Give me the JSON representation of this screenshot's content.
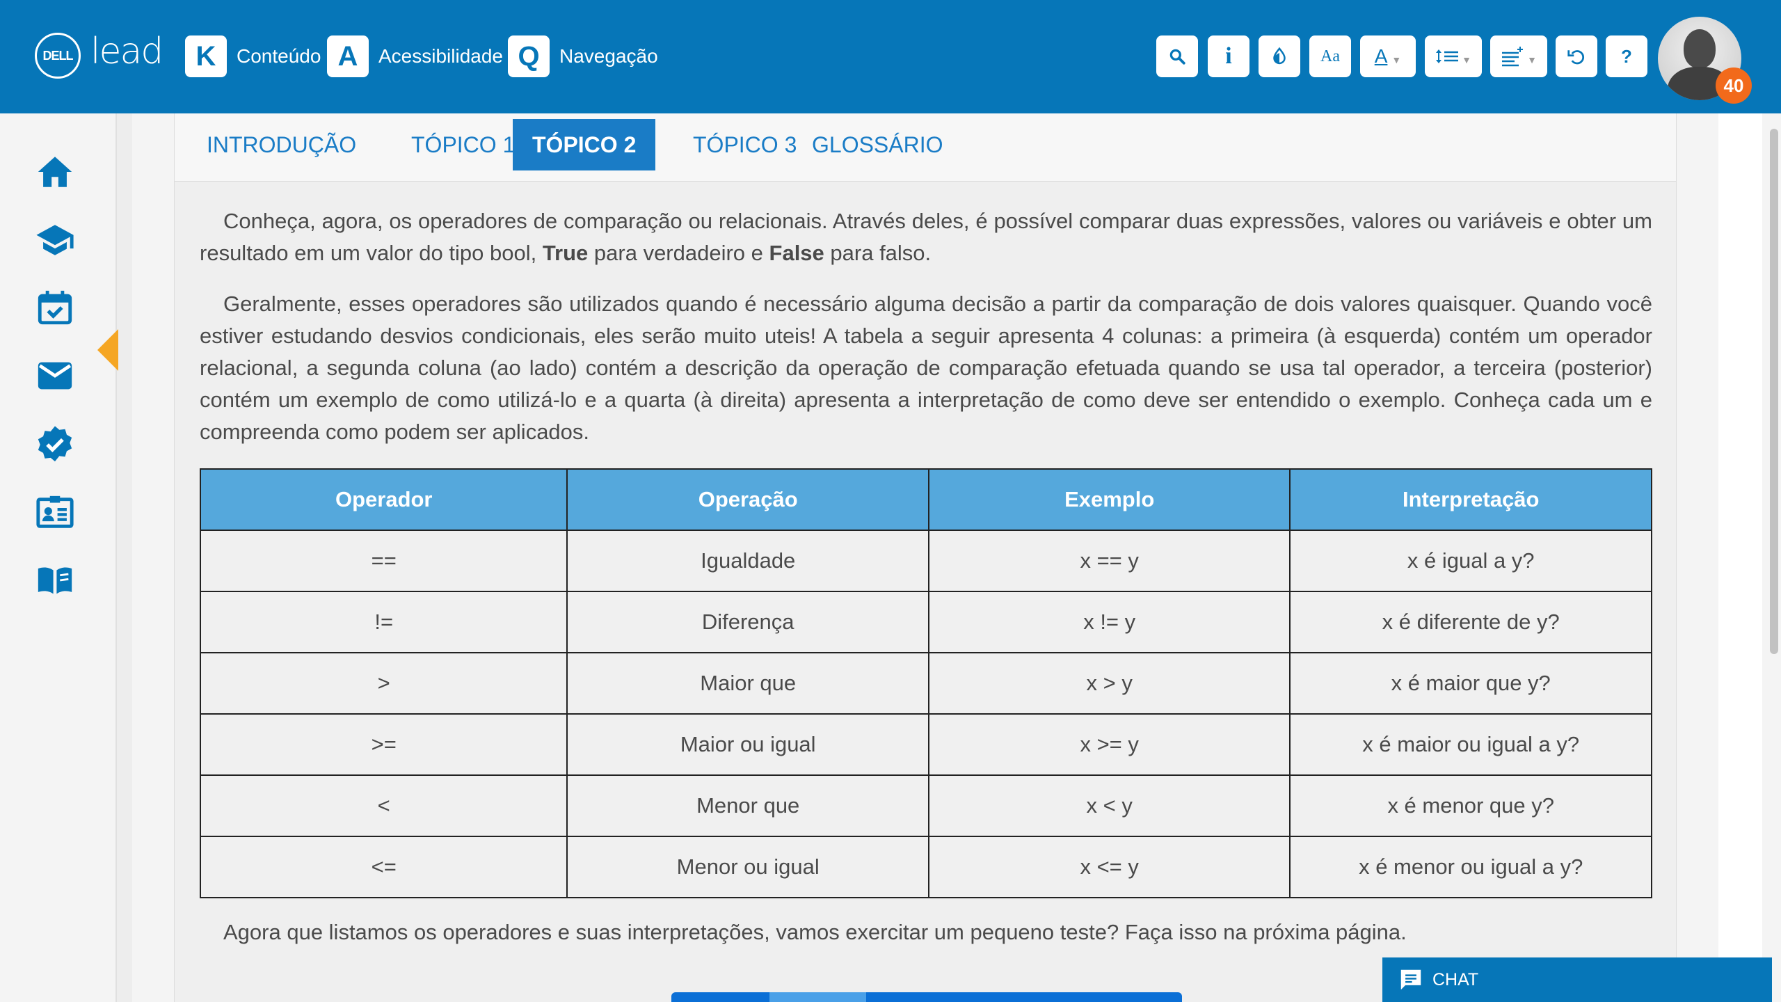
{
  "header": {
    "dell_logo": "DELL",
    "lead_logo": "lead",
    "shortcuts": [
      {
        "key": "K",
        "label": "Conteúdo"
      },
      {
        "key": "A",
        "label": "Acessibilidade"
      },
      {
        "key": "Q",
        "label": "Navegação"
      }
    ],
    "tools": {
      "search": "search-icon",
      "info": "i",
      "contrast": "contrast-icon",
      "font_size": "Aa",
      "font_color": "A",
      "line_spacing": "line-spacing-icon",
      "paragraph_spacing": "paragraph-spacing-icon",
      "reset": "undo-icon",
      "help": "?"
    },
    "notification_count": "40",
    "accent_color": "#0676b8",
    "badge_color": "#f26a1b"
  },
  "sidebar": {
    "items": [
      {
        "icon": "home-icon"
      },
      {
        "icon": "graduation-cap-icon"
      },
      {
        "icon": "calendar-check-icon"
      },
      {
        "icon": "mail-icon"
      },
      {
        "icon": "verified-badge-icon"
      },
      {
        "icon": "id-card-icon"
      },
      {
        "icon": "book-open-icon"
      }
    ]
  },
  "tabs": [
    {
      "label": "INTRODUÇÃO"
    },
    {
      "label": "TÓPICO 1"
    },
    {
      "label": "TÓPICO 2"
    },
    {
      "label": "TÓPICO 3"
    },
    {
      "label": "GLOSSÁRIO"
    }
  ],
  "content": {
    "p1_a": "Conheça, agora, os operadores de comparação ou relacionais. Através deles, é possível comparar duas expressões, valores ou variáveis e obter um resultado em um valor do tipo bool, ",
    "p1_true": "True",
    "p1_b": " para verdadeiro e ",
    "p1_false": "False",
    "p1_c": " para falso.",
    "p2": "Geralmente, esses operadores são utilizados quando é necessário alguma decisão a partir da comparação de dois valores quaisquer. Quando você estiver estudando desvios condicionais, eles serão muito uteis! A tabela a seguir apresenta 4 colunas: a primeira (à esquerda) contém um operador relacional, a segunda coluna (ao lado) contém a descrição da operação de comparação efetuada quando se usa tal operador, a terceira (posterior) contém um exemplo de como utilizá-lo e a quarta (à direita) apresenta a interpretação de como deve ser entendido o exemplo. Conheça cada um e compreenda como podem ser aplicados.",
    "p3": "Agora que listamos os operadores e suas interpretações, vamos exercitar um pequeno teste? Faça isso na próxima página."
  },
  "table": {
    "headers": [
      "Operador",
      "Operação",
      "Exemplo",
      "Interpretação"
    ],
    "rows": [
      [
        "==",
        "Igualdade",
        "x == y",
        "x é igual a y?"
      ],
      [
        "!=",
        "Diferença",
        "x != y",
        "x é diferente de y?"
      ],
      [
        ">",
        "Maior que",
        "x > y",
        "x é maior que y?"
      ],
      [
        ">=",
        "Maior ou igual",
        "x >= y",
        "x é maior ou igual a y?"
      ],
      [
        "<",
        "Menor que",
        "x < y",
        "x é menor que y?"
      ],
      [
        "<=",
        "Menor ou igual",
        "x <= y",
        "x é menor ou igual a y?"
      ]
    ]
  },
  "chat": {
    "label": "CHAT"
  }
}
